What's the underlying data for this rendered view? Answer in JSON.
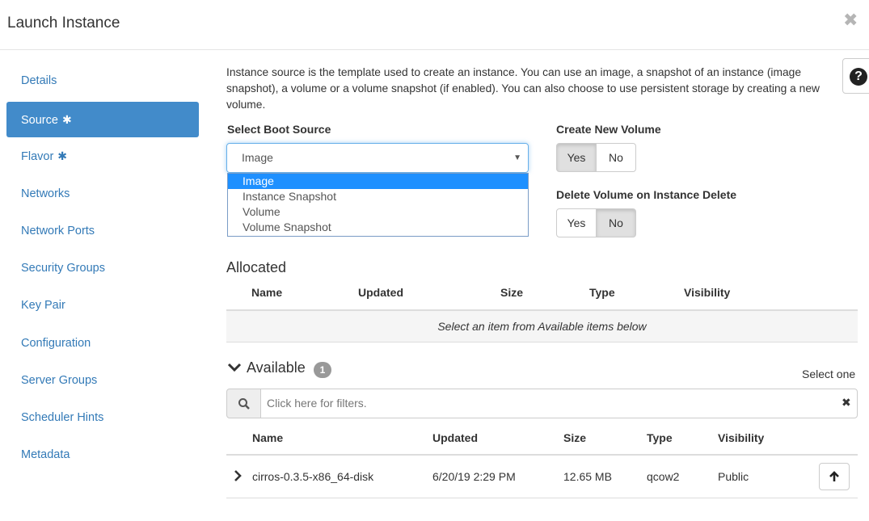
{
  "dialog": {
    "title": "Launch Instance",
    "close_glyph": "✖"
  },
  "nav": {
    "items": [
      {
        "label": "Details",
        "required": false,
        "active": false
      },
      {
        "label": "Source",
        "required": true,
        "active": true
      },
      {
        "label": "Flavor",
        "required": true,
        "active": false
      },
      {
        "label": "Networks",
        "required": false,
        "active": false
      },
      {
        "label": "Network Ports",
        "required": false,
        "active": false
      },
      {
        "label": "Security Groups",
        "required": false,
        "active": false
      },
      {
        "label": "Key Pair",
        "required": false,
        "active": false
      },
      {
        "label": "Configuration",
        "required": false,
        "active": false
      },
      {
        "label": "Server Groups",
        "required": false,
        "active": false
      },
      {
        "label": "Scheduler Hints",
        "required": false,
        "active": false
      },
      {
        "label": "Metadata",
        "required": false,
        "active": false
      }
    ],
    "required_glyph": "✱"
  },
  "source": {
    "intro": "Instance source is the template used to create an instance. You can use an image, a snapshot of an instance (image snapshot), a volume or a volume snapshot (if enabled). You can also choose to use persistent storage by creating a new volume.",
    "help_glyph": "?",
    "boot_source_label": "Select Boot Source",
    "boot_source_value": "Image",
    "caret_glyph": "▼",
    "boot_source_options": [
      "Image",
      "Instance Snapshot",
      "Volume",
      "Volume Snapshot"
    ],
    "create_volume_label": "Create New Volume",
    "create_volume_yes": "Yes",
    "create_volume_no": "No",
    "create_volume_selected": "Yes",
    "delete_volume_label": "Delete Volume on Instance Delete",
    "delete_volume_yes": "Yes",
    "delete_volume_no": "No",
    "delete_volume_selected": "No"
  },
  "allocated": {
    "title": "Allocated",
    "columns": [
      "Name",
      "Updated",
      "Size",
      "Type",
      "Visibility"
    ],
    "empty_message": "Select an item from Available items below"
  },
  "available": {
    "title": "Available",
    "count": "1",
    "select_hint": "Select one",
    "filter_placeholder": "Click here for filters.",
    "filter_clear_glyph": "✖",
    "columns": [
      "Name",
      "Updated",
      "Size",
      "Type",
      "Visibility"
    ],
    "rows": [
      {
        "name": "cirros-0.3.5-x86_64-disk",
        "updated": "6/20/19 2:29 PM",
        "size": "12.65 MB",
        "type": "qcow2",
        "visibility": "Public"
      }
    ]
  },
  "colors": {
    "accent": "#428bca",
    "link": "#337ab7",
    "selected_option": "#1e90ff"
  }
}
